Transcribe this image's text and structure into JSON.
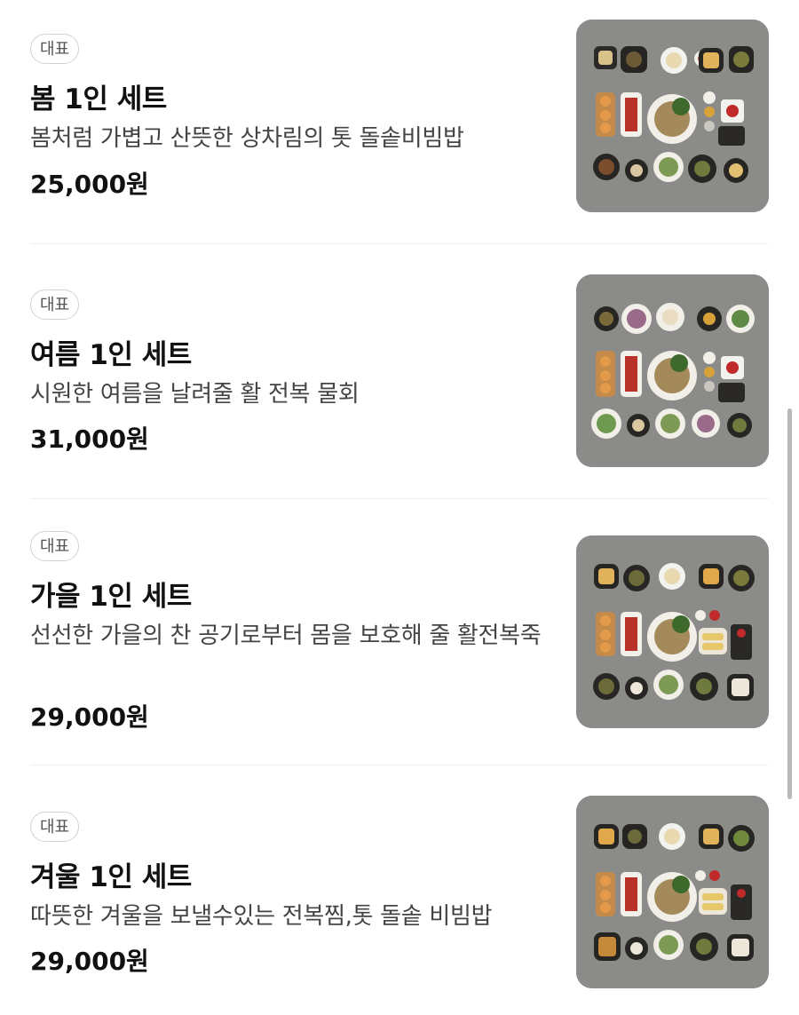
{
  "menu": {
    "items": [
      {
        "badge": "대표",
        "title": "봄 1인 세트",
        "description": "봄처럼 가볍고 산뜻한 상차림의 톳 돌솥비빔밥",
        "price": "25,000원",
        "image_alt": "spring-set-food-photo"
      },
      {
        "badge": "대표",
        "title": "여름 1인 세트",
        "description": "시원한 여름을 날려줄 활 전복 물회",
        "price": "31,000원",
        "image_alt": "summer-set-food-photo"
      },
      {
        "badge": "대표",
        "title": "가을 1인 세트",
        "description": "선선한 가을의 찬 공기로부터 몸을 보호해 줄 활전복죽",
        "price": "29,000원",
        "image_alt": "autumn-set-food-photo"
      },
      {
        "badge": "대표",
        "title": "겨울 1인 세트",
        "description": "따뜻한 겨울을 보낼수있는 전복찜,톳 돌솥 비빔밥",
        "price": "29,000원",
        "image_alt": "winter-set-food-photo"
      }
    ]
  },
  "colors": {
    "background": "#ffffff",
    "text_primary": "#111111",
    "text_secondary": "#444444",
    "badge_border": "#d2d2d2",
    "divider": "#eeeeee",
    "photo_background": "#8a8a88"
  }
}
